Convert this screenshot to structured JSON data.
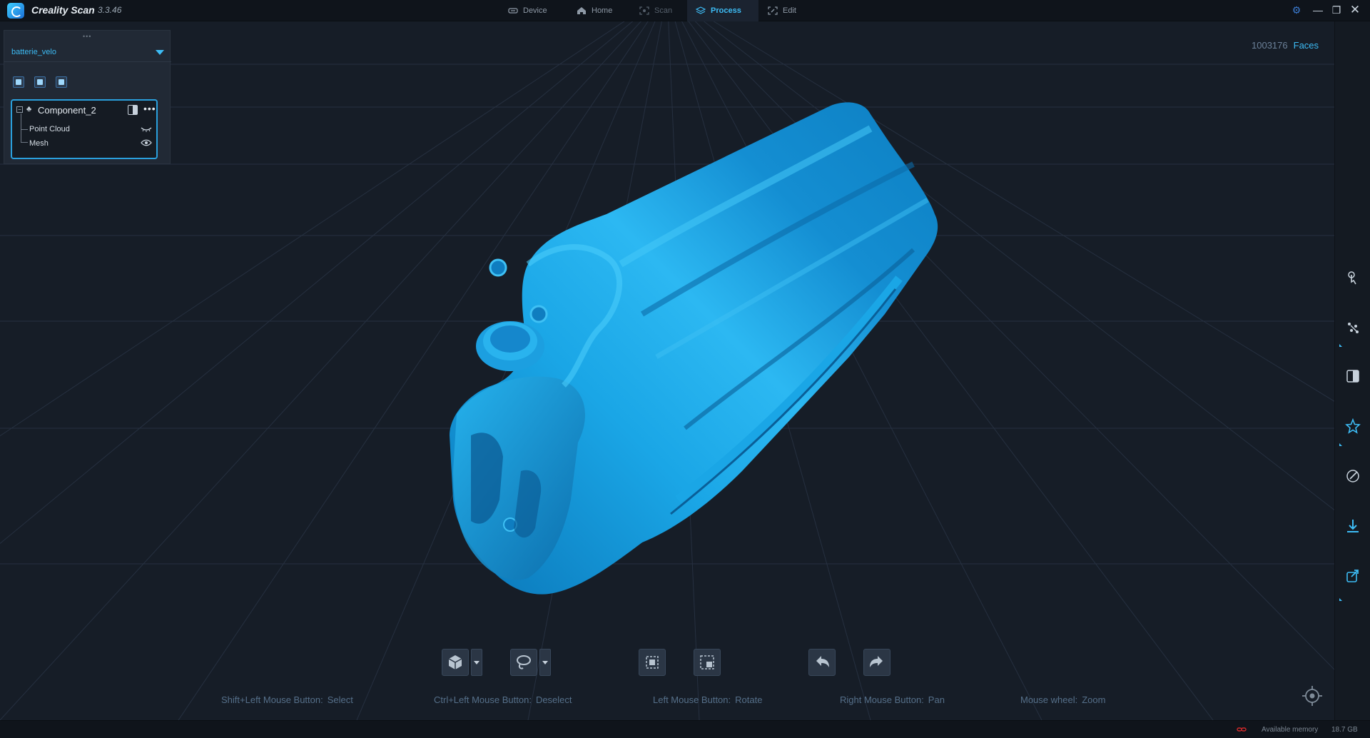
{
  "app": {
    "name": "Creality Scan",
    "version": "3.3.46"
  },
  "nav": {
    "tabs": [
      {
        "label": "Device",
        "icon": "device-icon"
      },
      {
        "label": "Home",
        "icon": "home-icon"
      },
      {
        "label": "Scan",
        "icon": "scan-icon",
        "disabled": true
      },
      {
        "label": "Process",
        "icon": "layers-icon",
        "active": true
      },
      {
        "label": "Edit",
        "icon": "edit-icon"
      }
    ]
  },
  "window_controls": [
    "settings-icon",
    "minimize-icon",
    "restore-icon",
    "close-icon"
  ],
  "viewport": {
    "face_count": "1003176",
    "face_label": "Faces",
    "model_color": "#1aa6e6",
    "background_color": "#161d27"
  },
  "project_panel": {
    "project_name": "batterie_velo",
    "tools": [
      "add-component-icon",
      "open-folder-icon",
      "document-icon"
    ],
    "component": {
      "name": "Component_2",
      "children": [
        {
          "label": "Point Cloud",
          "visible": false
        },
        {
          "label": "Mesh",
          "visible": true
        }
      ]
    }
  },
  "right_toolbar": [
    "touch-select-icon",
    "points-icon",
    "split-icon",
    "star-icon",
    "palette-icon",
    "download-icon",
    "export-icon"
  ],
  "bottom_toolbar": [
    "view-cube-icon",
    "lasso-select-icon",
    "select-through-icon",
    "invert-select-icon",
    "undo-icon",
    "redo-icon"
  ],
  "hints": [
    {
      "key": "Shift+Left Mouse Button:",
      "action": "Select"
    },
    {
      "key": "Ctrl+Left Mouse Button:",
      "action": "Deselect"
    },
    {
      "key": "Left Mouse Button:",
      "action": "Rotate"
    },
    {
      "key": "Right Mouse Button:",
      "action": "Pan"
    },
    {
      "key": "Mouse wheel:",
      "action": "Zoom"
    }
  ],
  "status": {
    "memory_label": "Available memory",
    "memory_value": "18.7 GB"
  },
  "colors": {
    "accent": "#3dbcf5",
    "model": "#1aa6e6",
    "panel": "#212935"
  }
}
